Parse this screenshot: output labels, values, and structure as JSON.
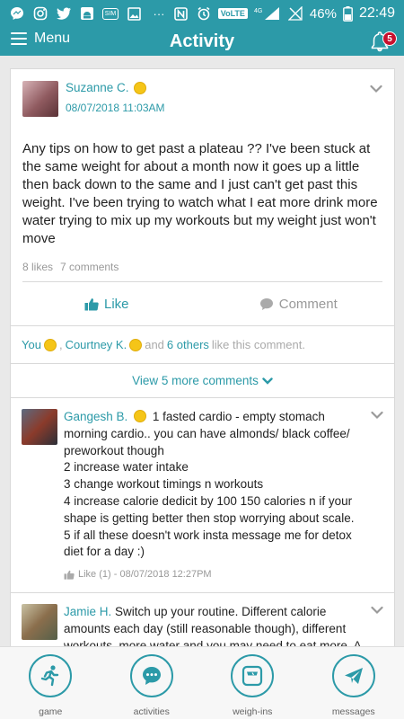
{
  "status_bar": {
    "volte": "VoLTE",
    "network": "4G",
    "battery": "46%",
    "time": "22:49",
    "sim_label": "SIM"
  },
  "header": {
    "menu_label": "Menu",
    "title": "Activity",
    "notification_count": "5"
  },
  "post": {
    "author": "Suzanne C.",
    "date": "08/07/2018 11:03AM",
    "body": "Any tips on how to get past a plateau ?? I've been stuck at the same weight for about a month now it goes up a little then back down to the same and I just can't get past this weight. I've been trying to watch what I eat more drink more water trying to mix up my workouts but my weight just won't move",
    "likes": "8 likes",
    "comments": "7 comments",
    "like_label": "Like",
    "comment_label": "Comment"
  },
  "likers": {
    "you": "You",
    "comma": ",",
    "person": "Courtney K.",
    "and": "and",
    "others": "6 others",
    "suffix": "like this comment."
  },
  "view_more": "View 5 more comments",
  "comments": [
    {
      "author": "Gangesh B.",
      "lines": [
        "1 fasted cardio - empty stomach morning cardio.. you can have almonds/ black coffee/ preworkout though",
        "2 increase water intake",
        "3 change workout timings n workouts",
        "4 increase calorie dedicit by 100 150 calories n if your shape is getting better then stop worrying about scale.",
        "5 if all these doesn't work insta message me for detox diet for a day :)"
      ],
      "meta": "Like (1) - 08/07/2018 12:27PM"
    },
    {
      "author": "Jamie H.",
      "text": "Switch up your routine. Different calorie amounts each day (still reasonable though), different workouts, more water and you may need to eat more. A nutritionist told me once that I had to eat more carbs to get past my plateau and I thought she was nuts. Really"
    }
  ],
  "bottom_nav": [
    {
      "label": "game",
      "icon": "runner-icon"
    },
    {
      "label": "activities",
      "icon": "chat-bubble-icon"
    },
    {
      "label": "weigh-ins",
      "icon": "scale-icon"
    },
    {
      "label": "messages",
      "icon": "paper-plane-icon"
    }
  ],
  "colors": {
    "brand": "#2c9aa8",
    "badge": "#c8102e",
    "coin": "#f5c518"
  }
}
